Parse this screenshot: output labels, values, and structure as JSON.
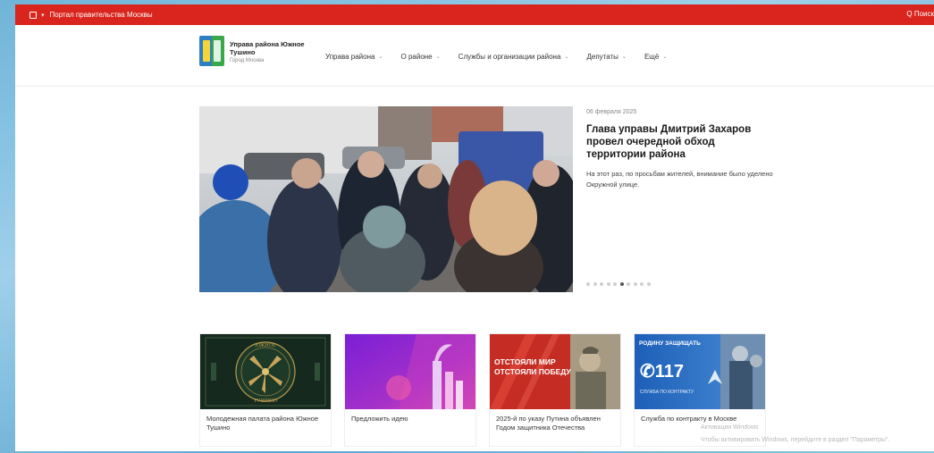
{
  "topbar": {
    "portal_label": "Портал правительства Москвы",
    "search_label": "Q Поиск",
    "color": "#d9251e"
  },
  "header": {
    "brand_name": "Управа района Южное Тушино",
    "brand_sub": "Город Москва",
    "nav": [
      {
        "label": "Управа района"
      },
      {
        "label": "О районе"
      },
      {
        "label": "Службы и организации района"
      },
      {
        "label": "Депутаты"
      },
      {
        "label": "Ещё"
      }
    ]
  },
  "hero": {
    "date": "06 февраля 2025",
    "title": "Глава управы Дмитрий Захаров провел очередной обход территории района",
    "text": "На этот раз, по просьбам жителей, внимание было уделено Окружной улице.",
    "slide_count": 10,
    "active_slide_index": 5
  },
  "cards": [
    {
      "caption": "Молодежная палата района Южное Тушино",
      "image_text": "ЮЖНОЕ ТУШИНО"
    },
    {
      "caption": "Предложить идею"
    },
    {
      "caption": "2025-й по указу Путина объявлен Годом защитника Отечества",
      "image_text": "ОТСТОЯЛИ МИР ОТСТОЯЛИ ПОБЕДУ"
    },
    {
      "caption": "Служба по контракту в Москве",
      "image_text": "117",
      "image_subtext": "СЛУЖБА ПО КОНТРАКТУ",
      "image_header": "РОДИНУ ЗАЩИЩАТЬ"
    }
  ],
  "watermark": {
    "line1": "Активация Windows",
    "line2": "Чтобы активировать Windows, перейдите в раздел \"Параметры\"."
  }
}
